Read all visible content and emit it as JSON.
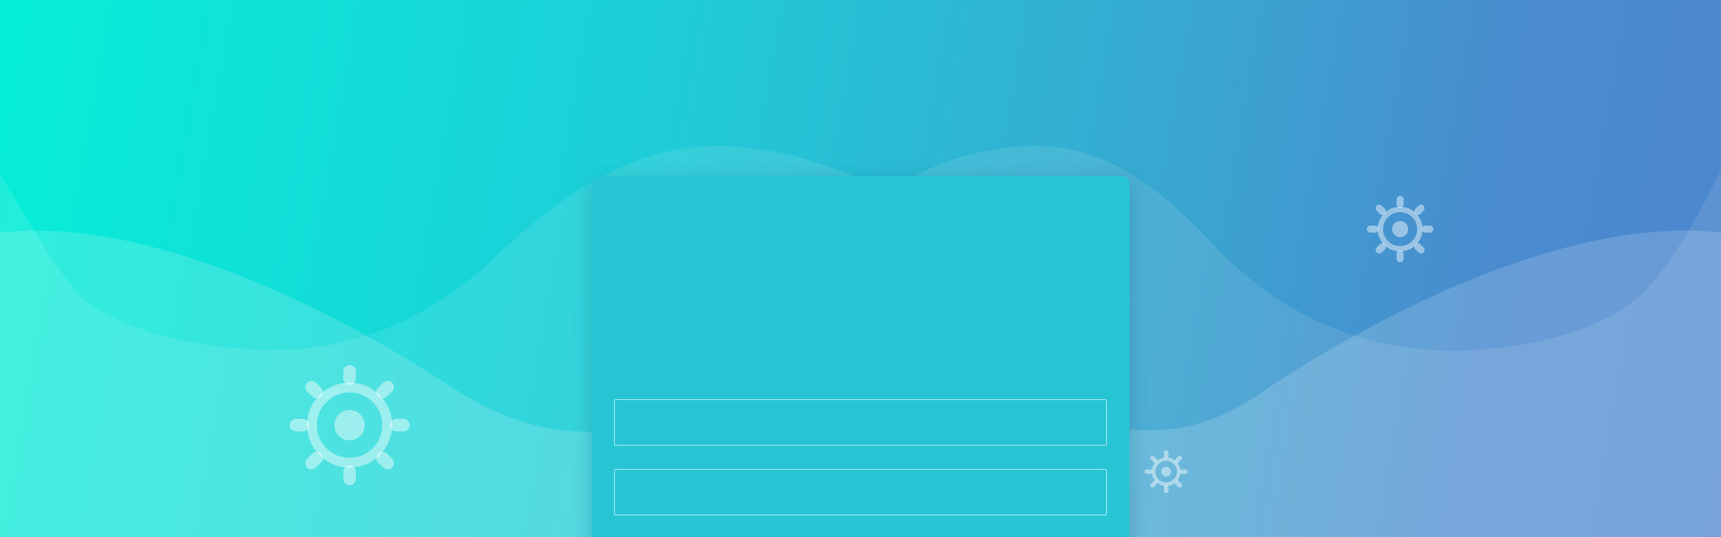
{
  "page": {
    "title": "",
    "background_colors": [
      "#06efd7",
      "#33afd2",
      "#4c86cf"
    ]
  },
  "decorations": {
    "icons": [
      "gear-icon",
      "gear-icon",
      "gear-icon"
    ]
  },
  "form": {
    "card_color": "#27c5d4",
    "fields": [
      {
        "value": "",
        "placeholder": ""
      },
      {
        "value": "",
        "placeholder": ""
      }
    ]
  }
}
